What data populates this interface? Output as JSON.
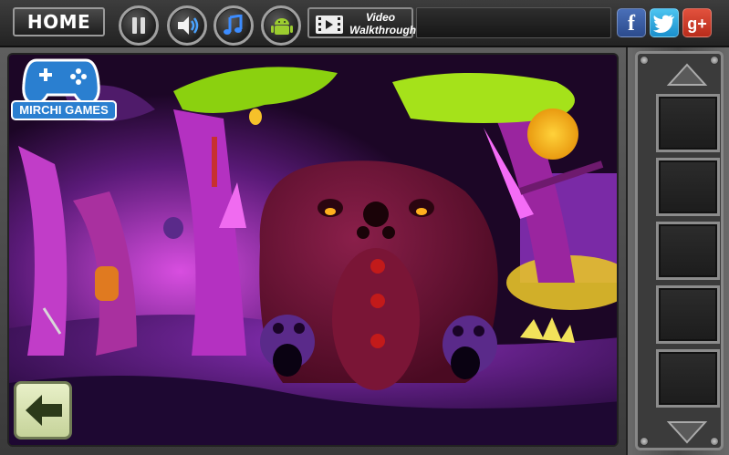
{
  "toolbar": {
    "home_label": "HOME",
    "video_label_line1": "Video",
    "video_label_line2": "Walkthrough",
    "pause_icon": "pause-icon",
    "sound_icon": "speaker-icon",
    "music_icon": "music-note-icon",
    "android_icon": "android-icon"
  },
  "social": {
    "facebook": "f",
    "twitter": "t",
    "googleplus": "g+"
  },
  "logo": {
    "text": "MIRCHI GAMES",
    "icon": "gamepad-icon"
  },
  "scene": {
    "description_icon": "haunted-forest-scene",
    "back_icon": "back-arrow-icon"
  },
  "inventory": {
    "up_icon": "up-arrow-icon",
    "down_icon": "down-arrow-icon",
    "slots": [
      "",
      "",
      "",
      "",
      ""
    ]
  },
  "colors": {
    "facebook": "#3b5998",
    "twitter": "#1da1f2",
    "googleplus": "#dd4b39",
    "moon": "#f5b21a",
    "foliage": "#8bd10f",
    "tree": "#c03ad0"
  }
}
